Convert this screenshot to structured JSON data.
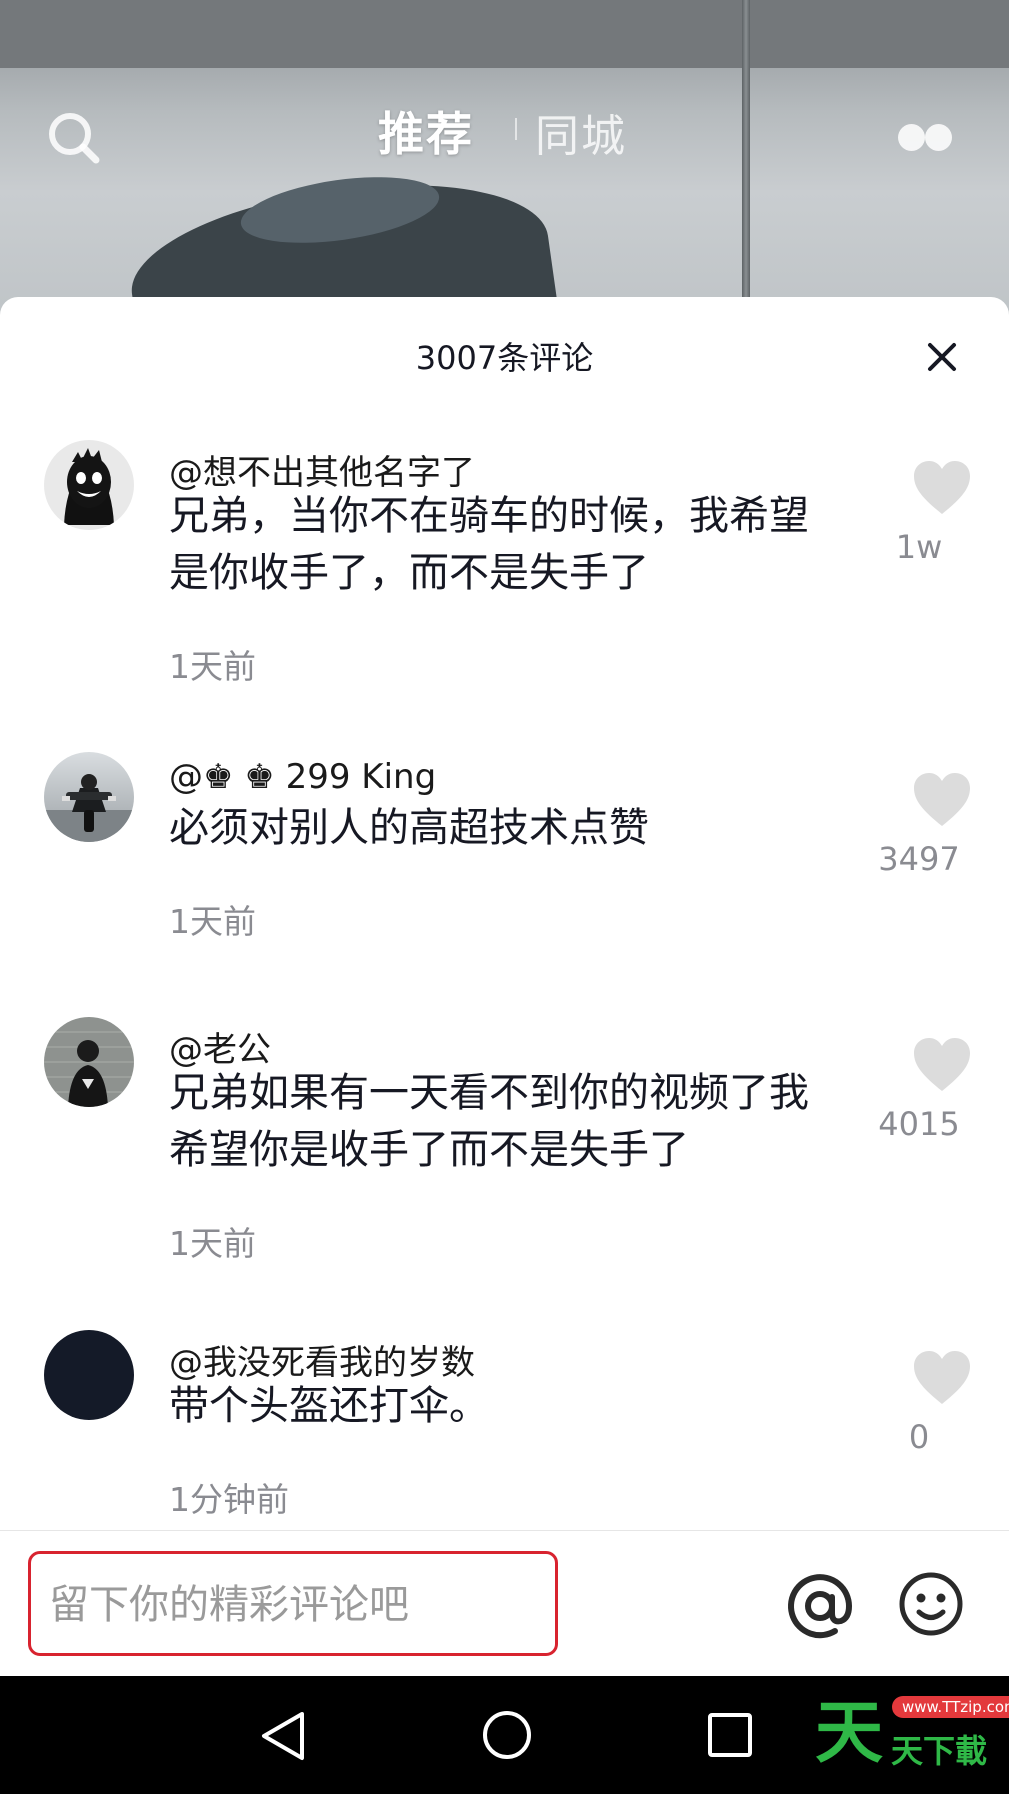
{
  "top_nav": {
    "search_icon": "search-icon",
    "tab_active": "推荐",
    "tab_other": "同城",
    "more_icon": "dots-icon"
  },
  "comment_panel": {
    "title": "3007条评论",
    "close_icon": "close-icon",
    "comments": [
      {
        "user": "@想不出其他名字了",
        "text": "兄弟，当你不在骑车的时候，我希望是你收手了，而不是失手了",
        "time": "1天前",
        "likes": "1w",
        "avatar": "dark-face-avatar"
      },
      {
        "user": "@♚ ♚ 299 King",
        "text": "必须对别人的高超技术点赞",
        "time": "1天前",
        "likes": "3497",
        "avatar": "motorcycle-avatar"
      },
      {
        "user": "@老公",
        "text": "兄弟如果有一天看不到你的视频了我希望你是收手了而不是失手了",
        "time": "1天前",
        "likes": "4015",
        "avatar": "person-avatar"
      },
      {
        "user": "@我没死看我的岁数",
        "text": "带个头盔还打伞。",
        "time": "1分钟前",
        "likes": "0",
        "avatar": "dark-circle-avatar"
      }
    ]
  },
  "input_bar": {
    "placeholder": "留下你的精彩评论吧",
    "at_icon": "at-icon",
    "emoji_icon": "emoji-icon",
    "highlight_color": "#d8232f"
  },
  "android_nav": {
    "back_icon": "back-icon",
    "home_icon": "home-icon",
    "recent_icon": "recent-apps-icon"
  },
  "watermark": {
    "big_char": "天",
    "url": "www.TTzip.com",
    "text": "天下載"
  }
}
